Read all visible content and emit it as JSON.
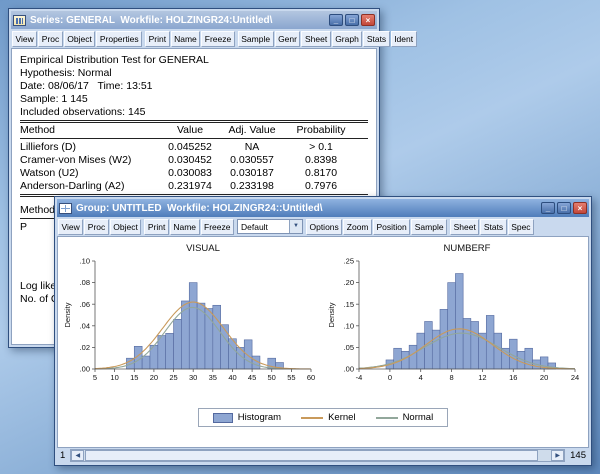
{
  "icons": {
    "minimize": "_",
    "maximize": "□",
    "close": "×",
    "dropdown_arrow": "▼",
    "scroll_left": "◀",
    "scroll_right": "▶"
  },
  "colors": {
    "titlebar_active": "#4f7cba",
    "titlebar_inactive": "#8aa6cf",
    "hist_fill": "#8ea6d2",
    "hist_edge": "#54699f",
    "kernel": "#c99a5b",
    "normal": "#92a79b"
  },
  "series_window": {
    "title": "Series: GENERAL  Workfile: HOLZINGR24:Untitled\\",
    "toolbar_groups": [
      [
        "View",
        "Proc",
        "Object",
        "Properties"
      ],
      [
        "Print",
        "Name",
        "Freeze"
      ],
      [
        "Sample",
        "Genr",
        "Sheet",
        "Graph",
        "Stats",
        "Ident"
      ]
    ],
    "lines": [
      "Empirical Distribution Test for GENERAL",
      "Hypothesis: Normal",
      "Date: 08/06/17   Time: 13:51",
      "Sample: 1 145",
      "Included observations: 145"
    ],
    "table": {
      "columns": [
        "Method",
        "Value",
        "Adj. Value",
        "Probability"
      ],
      "rows": [
        [
          "Lilliefors (D)",
          "0.045252",
          "NA",
          "> 0.1"
        ],
        [
          "Cramer-von Mises (W2)",
          "0.030452",
          "0.030557",
          "0.8398"
        ],
        [
          "Watson (U2)",
          "0.030083",
          "0.030187",
          "0.8170"
        ],
        [
          "Anderson-Darling (A2)",
          "0.231974",
          "0.233198",
          "0.7976"
        ]
      ]
    },
    "partial_lines": [
      "Method:",
      "P",
      "Log likel",
      "No. of C"
    ]
  },
  "group_window": {
    "title": "Group: UNTITLED  Workfile: HOLZINGR24::Untitled\\",
    "toolbar_groups_left": [
      [
        "View",
        "Proc",
        "Object"
      ],
      [
        "Print",
        "Name",
        "Freeze"
      ]
    ],
    "dropdown_value": "Default",
    "toolbar_groups_right": [
      [
        "Options",
        "Zoom",
        "Position",
        "Sample"
      ],
      [
        "Sheet",
        "Stats",
        "Spec"
      ]
    ],
    "legend": {
      "histogram": "Histogram",
      "kernel": "Kernel",
      "normal": "Normal"
    },
    "scroll": {
      "left_label": "1",
      "right_label": "145"
    }
  },
  "chart_data": [
    {
      "type": "bar",
      "subtype": "histogram_with_density_curves",
      "title": "VISUAL",
      "xlabel": "",
      "ylabel": "Density",
      "xlim": [
        5,
        60
      ],
      "ylim": [
        0,
        0.1
      ],
      "xticks": [
        5,
        10,
        15,
        20,
        25,
        30,
        35,
        40,
        45,
        50,
        55,
        60
      ],
      "ytick_labels": [
        ".00",
        ".02",
        ".04",
        ".06",
        ".08",
        ".10"
      ],
      "ytick_values": [
        0,
        0.02,
        0.04,
        0.06,
        0.08,
        0.1
      ],
      "bin_width": 2,
      "bar_centers": [
        14,
        16,
        18,
        20,
        22,
        24,
        26,
        28,
        30,
        32,
        34,
        36,
        38,
        40,
        42,
        44,
        46,
        50,
        52
      ],
      "bar_heights": [
        0.01,
        0.021,
        0.012,
        0.022,
        0.031,
        0.033,
        0.046,
        0.063,
        0.08,
        0.061,
        0.056,
        0.059,
        0.041,
        0.028,
        0.02,
        0.027,
        0.012,
        0.01,
        0.006
      ],
      "curves": {
        "kernel": {
          "shape": "gaussian",
          "mean": 30.0,
          "sd": 7.8,
          "peak": 0.062
        },
        "normal": {
          "shape": "gaussian",
          "mean": 29.8,
          "sd": 7.0,
          "peak": 0.057
        }
      }
    },
    {
      "type": "bar",
      "subtype": "histogram_with_density_curves",
      "title": "NUMBERF",
      "xlabel": "",
      "ylabel": "Density",
      "xlim": [
        -4,
        24
      ],
      "ylim": [
        0,
        0.25
      ],
      "xticks": [
        -4,
        0,
        4,
        8,
        12,
        16,
        20,
        24
      ],
      "ytick_labels": [
        ".00",
        ".05",
        ".10",
        ".15",
        ".20",
        ".25"
      ],
      "ytick_values": [
        0,
        0.05,
        0.1,
        0.15,
        0.2,
        0.25
      ],
      "bin_width": 1,
      "bar_centers": [
        0,
        1,
        2,
        3,
        4,
        5,
        6,
        7,
        8,
        9,
        10,
        11,
        12,
        13,
        14,
        15,
        16,
        17,
        18,
        19,
        20,
        21
      ],
      "bar_heights": [
        0.021,
        0.048,
        0.041,
        0.055,
        0.083,
        0.11,
        0.09,
        0.138,
        0.2,
        0.221,
        0.117,
        0.11,
        0.083,
        0.124,
        0.083,
        0.048,
        0.069,
        0.041,
        0.048,
        0.021,
        0.028,
        0.014
      ],
      "curves": {
        "kernel": {
          "shape": "gaussian",
          "mean": 9.0,
          "sd": 4.3,
          "peak": 0.093
        },
        "normal": {
          "shape": "gaussian",
          "mean": 9.3,
          "sd": 4.8,
          "peak": 0.083
        }
      }
    }
  ]
}
